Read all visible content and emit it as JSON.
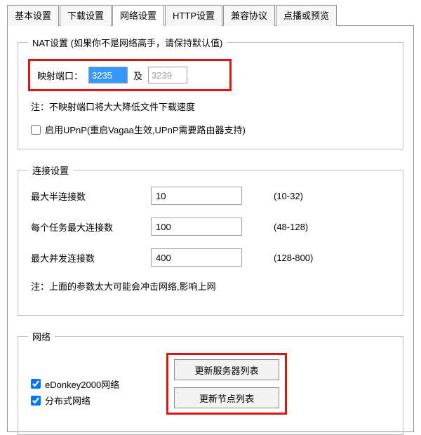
{
  "tabs": {
    "basic": "基本设置",
    "download": "下载设置",
    "network": "网络设置",
    "http": "HTTP设置",
    "compat": "兼容协议",
    "preview": "点播或预览"
  },
  "nat": {
    "legend": "NAT设置  (如果你不是网络高手，请保持默认值)",
    "port_label": "映射端口：",
    "port1": "3235",
    "and": "及",
    "port2": "3239",
    "note": "注：不映射端口将大大降低文件下载速度",
    "upnp_label": "启用UPnP(重启Vagaa生效,UPnP需要路由器支持)"
  },
  "conn": {
    "legend": "连接设置",
    "half_label": "最大半连接数",
    "half_value": "10",
    "half_range": "(10-32)",
    "pertask_label": "每个任务最大连接数",
    "pertask_value": "100",
    "pertask_range": "(48-128)",
    "concurrent_label": "最大并发连接数",
    "concurrent_value": "400",
    "concurrent_range": "(128-800)",
    "note": "注：上面的参数太大可能会冲击网络,影响上网"
  },
  "net": {
    "legend": "网络",
    "ed2k_label": "eDonkey2000网络",
    "ed2k_btn": "更新服务器列表",
    "dist_label": "分布式网络",
    "dist_btn": "更新节点列表"
  }
}
